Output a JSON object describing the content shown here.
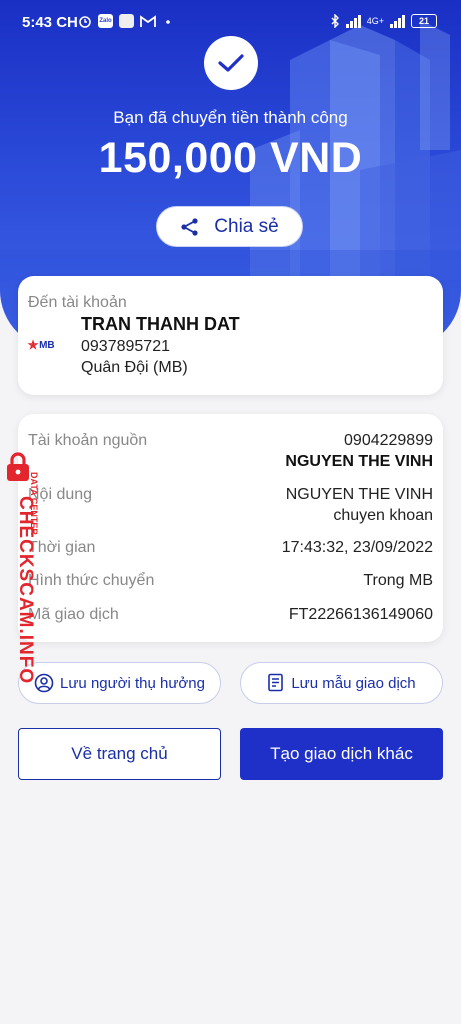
{
  "status_bar": {
    "time": "5:43 CH",
    "network": "4G+",
    "battery": "21",
    "icons": [
      "alarm-icon",
      "zalo-icon",
      "square-icon",
      "gmail-icon",
      "dot-icon",
      "bluetooth-icon",
      "signal-icon"
    ]
  },
  "hero": {
    "success_text": "Bạn đã chuyển tiền thành công",
    "amount": "150,000 VND",
    "share_label": "Chia sẻ"
  },
  "recipient": {
    "label": "Đến tài khoản",
    "bank_logo": "MB",
    "name": "TRAN THANH DAT",
    "account": "0937895721",
    "bank": "Quân Đội (MB)"
  },
  "details": {
    "source_label": "Tài khoản nguồn",
    "source_account": "0904229899",
    "source_name": "NGUYEN THE VINH",
    "content_label": "Nội dung",
    "content_line1": "NGUYEN THE VINH",
    "content_line2": "chuyen khoan",
    "time_label": "Thời gian",
    "time_value": "17:43:32, 23/09/2022",
    "method_label": "Hình thức chuyển",
    "method_value": "Trong MB",
    "txn_label": "Mã giao dịch",
    "txn_value": "FT22266136149060"
  },
  "actions": {
    "save_beneficiary": "Lưu người thụ hưởng",
    "save_template": "Lưu mẫu giao dịch",
    "home": "Về trang chủ",
    "new_transaction": "Tạo giao dịch khác"
  },
  "watermark": {
    "main": "CHECKSCAM.INFO",
    "sub": "DATA CENTER"
  },
  "colors": {
    "brand_blue": "#1f30c8",
    "watermark_red": "#e3262d",
    "background": "#f4f4f6"
  }
}
